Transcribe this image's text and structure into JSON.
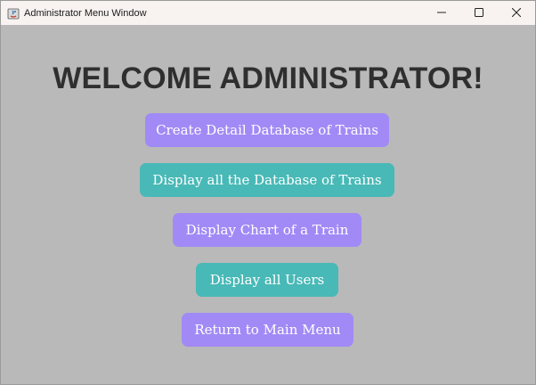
{
  "window": {
    "title": "Administrator Menu Window",
    "controls": [
      "minimize-icon",
      "maximize-icon",
      "close-icon"
    ]
  },
  "main": {
    "heading": "WELCOME ADMINISTRATOR!",
    "buttons": [
      {
        "label": "Create Detail Database of Trains",
        "color": "#a18af6"
      },
      {
        "label": "Display all the Database of Trains",
        "color": "#48b9b6"
      },
      {
        "label": "Display Chart of a Train",
        "color": "#a18af6"
      },
      {
        "label": "Display all Users",
        "color": "#48b9b6"
      },
      {
        "label": "Return to Main Menu",
        "color": "#a18af6"
      }
    ]
  },
  "colors": {
    "background": "#b9b9b9",
    "titlebar": "#f8f3f1",
    "heading_text": "#2f2f2f",
    "purple": "#a18af6",
    "teal": "#48b9b6"
  }
}
